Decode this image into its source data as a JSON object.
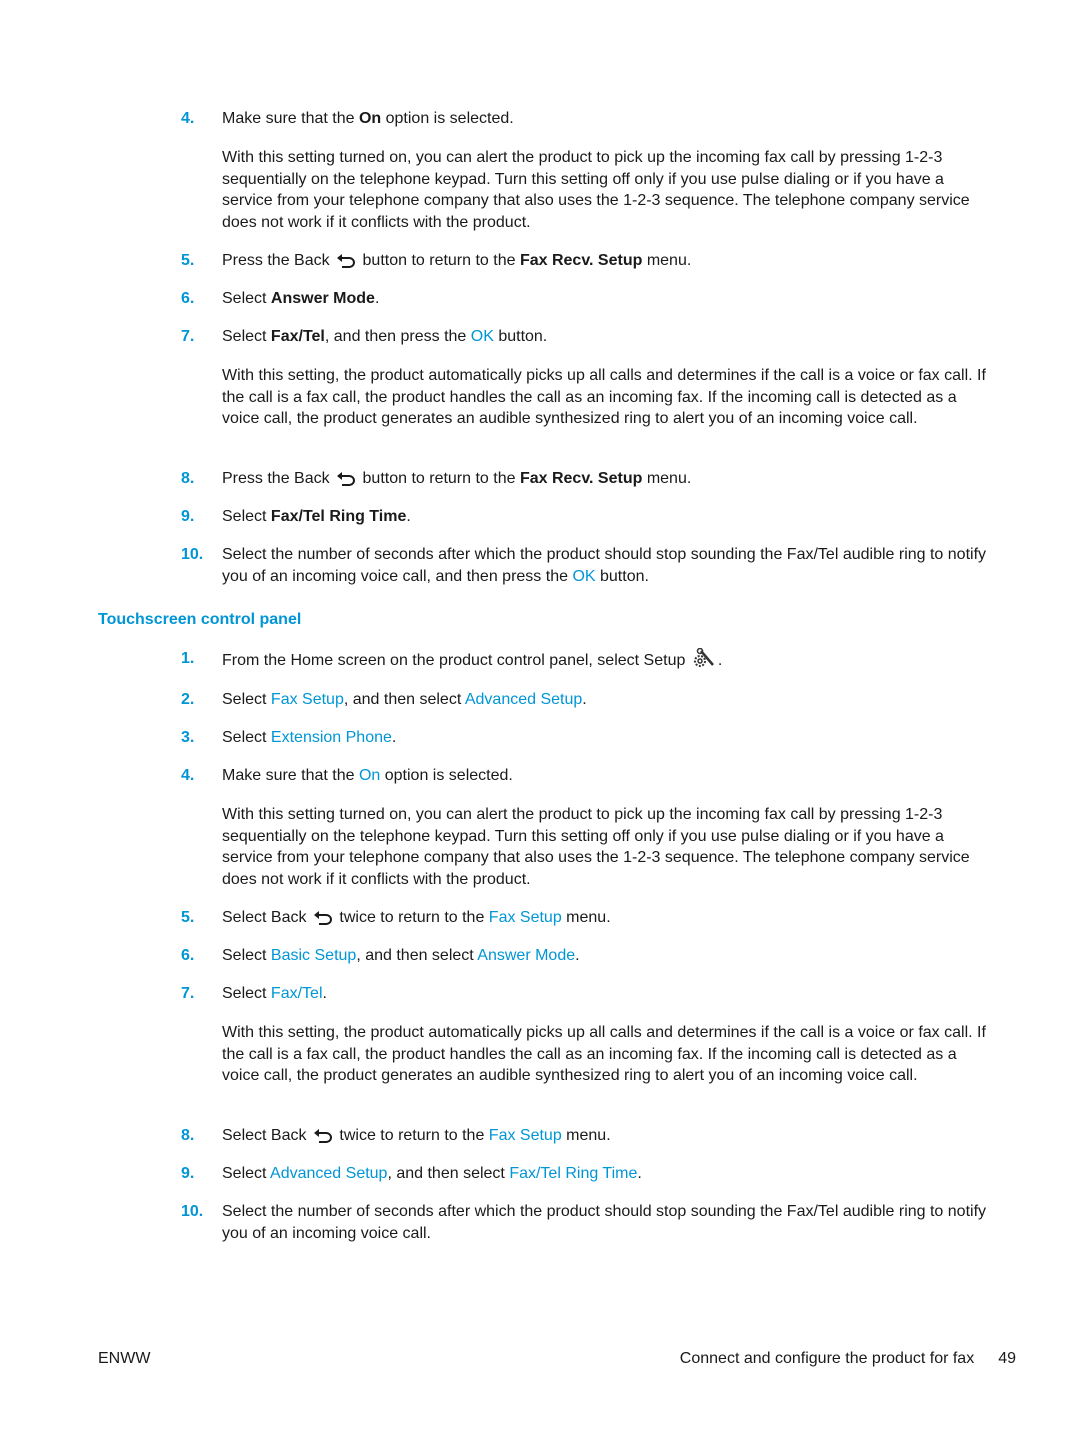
{
  "section1": {
    "step4": {
      "num": "4.",
      "a": "Make sure that the ",
      "b": "On",
      "c": " option is selected."
    },
    "para4": "With this setting turned on, you can alert the product to pick up the incoming fax call by pressing 1-2-3 sequentially on the telephone keypad. Turn this setting off only if you use pulse dialing or if you have a service from your telephone company that also uses the 1-2-3 sequence. The telephone company service does not work if it conflicts with the product.",
    "step5": {
      "num": "5.",
      "a": "Press the Back",
      "b": "button to return to the ",
      "c": "Fax Recv. Setup",
      "d": " menu."
    },
    "step6": {
      "num": "6.",
      "a": "Select ",
      "b": "Answer Mode",
      "c": "."
    },
    "step7": {
      "num": "7.",
      "a": "Select ",
      "b": "Fax/Tel",
      "c": ", and then press the ",
      "d": "OK",
      "e": " button."
    },
    "para7": "With this setting, the product automatically picks up all calls and determines if the call is a voice or fax call. If the call is a fax call, the product handles the call as an incoming fax. If the incoming call is detected as a voice call, the product generates an audible synthesized ring to alert you of an incoming voice call.",
    "step8": {
      "num": "8.",
      "a": "Press the Back",
      "b": "button to return to the ",
      "c": "Fax Recv. Setup",
      "d": " menu."
    },
    "step9": {
      "num": "9.",
      "a": "Select ",
      "b": "Fax/Tel Ring Time",
      "c": "."
    },
    "step10": {
      "num": "10.",
      "a": "Select the number of seconds after which the product should stop sounding the Fax/Tel audible ring to notify you of an incoming voice call, and then press the ",
      "b": "OK",
      "c": " button."
    }
  },
  "section2": {
    "heading": "Touchscreen control panel",
    "step1": {
      "num": "1.",
      "a": "From the Home screen on the product control panel, select Setup",
      "b": "."
    },
    "step2": {
      "num": "2.",
      "a": "Select ",
      "b": "Fax Setup",
      "c": ", and then select ",
      "d": "Advanced Setup",
      "e": "."
    },
    "step3": {
      "num": "3.",
      "a": "Select ",
      "b": "Extension Phone",
      "c": "."
    },
    "step4": {
      "num": "4.",
      "a": "Make sure that the ",
      "b": "On",
      "c": " option is selected."
    },
    "para4": "With this setting turned on, you can alert the product to pick up the incoming fax call by pressing 1-2-3 sequentially on the telephone keypad. Turn this setting off only if you use pulse dialing or if you have a service from your telephone company that also uses the 1-2-3 sequence. The telephone company service does not work if it conflicts with the product.",
    "step5": {
      "num": "5.",
      "a": "Select Back",
      "b": "twice to return to the ",
      "c": "Fax Setup",
      "d": " menu."
    },
    "step6": {
      "num": "6.",
      "a": "Select ",
      "b": "Basic Setup",
      "c": ", and then select ",
      "d": "Answer Mode",
      "e": "."
    },
    "step7": {
      "num": "7.",
      "a": "Select ",
      "b": "Fax/Tel",
      "c": "."
    },
    "para7": "With this setting, the product automatically picks up all calls and determines if the call is a voice or fax call. If the call is a fax call, the product handles the call as an incoming fax. If the incoming call is detected as a voice call, the product generates an audible synthesized ring to alert you of an incoming voice call.",
    "step8": {
      "num": "8.",
      "a": "Select Back",
      "b": "twice to return to the ",
      "c": "Fax Setup",
      "d": " menu."
    },
    "step9": {
      "num": "9.",
      "a": "Select ",
      "b": "Advanced Setup",
      "c": ", and then select ",
      "d": "Fax/Tel Ring Time",
      "e": "."
    },
    "step10": {
      "num": "10.",
      "a": "Select the number of seconds after which the product should stop sounding the Fax/Tel audible ring to notify you of an incoming voice call."
    }
  },
  "footer": {
    "left": "ENWW",
    "title": "Connect and configure the product for fax",
    "page": "49"
  },
  "colors": {
    "accent": "#0096d6",
    "text": "#1a1a1a"
  }
}
